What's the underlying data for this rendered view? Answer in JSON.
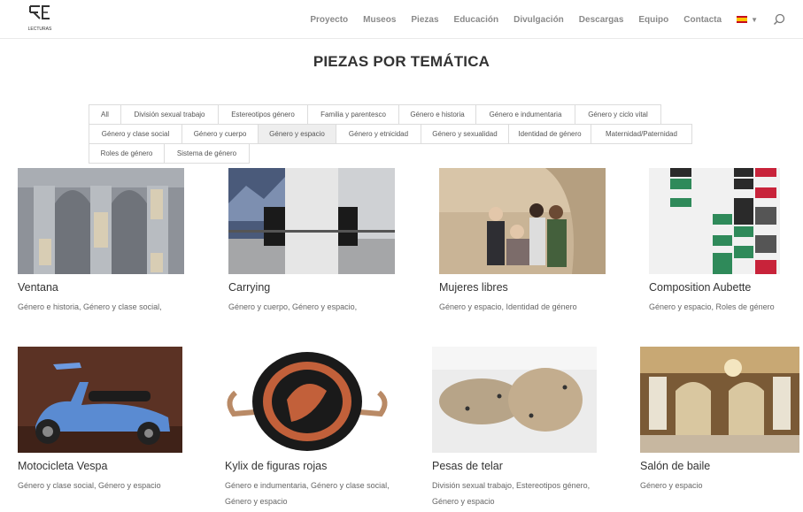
{
  "header": {
    "logo_text": "LECTURAS",
    "nav": [
      "Proyecto",
      "Museos",
      "Piezas",
      "Educación",
      "Divulgación",
      "Descargas",
      "Equipo",
      "Contacta"
    ]
  },
  "page": {
    "title": "PIEZAS POR TEMÁTICA"
  },
  "filters": {
    "row1": [
      "All",
      "División sexual trabajo",
      "Estereotipos género",
      "Familia y parentesco",
      "Género e historia",
      "Género e indumentaria",
      "Género y ciclo vital"
    ],
    "row2": [
      "Género y clase social",
      "Género y cuerpo",
      "Género y espacio",
      "Género y etnicidad",
      "Género y sexualidad",
      "Identidad de género",
      "Maternidad/Paternidad"
    ],
    "row3": [
      "Roles de género",
      "Sistema de género"
    ],
    "active": "Género y espacio"
  },
  "pieces": [
    {
      "title": "Ventana",
      "tags": "Género e historia, Género y clase social,"
    },
    {
      "title": "Carrying",
      "tags": "Género y cuerpo, Género y espacio,"
    },
    {
      "title": "Mujeres libres",
      "tags": "Género y espacio, Identidad de género"
    },
    {
      "title": "Composition Aubette",
      "tags": "Género y espacio, Roles de género"
    },
    {
      "title": "Motocicleta Vespa",
      "tags": "Género y clase social, Género y espacio"
    },
    {
      "title": "Kylix de figuras rojas",
      "tags": "Género e indumentaria, Género y clase social, Género y espacio"
    },
    {
      "title": "Pesas de telar",
      "tags": "División sexual trabajo, Estereotipos género, Género y espacio"
    },
    {
      "title": "Salón de baile",
      "tags": "Género y espacio"
    }
  ],
  "colors": {
    "nav_text": "#8a8a8a",
    "title_text": "#333333",
    "active_tab_bg": "#eeeeee"
  }
}
